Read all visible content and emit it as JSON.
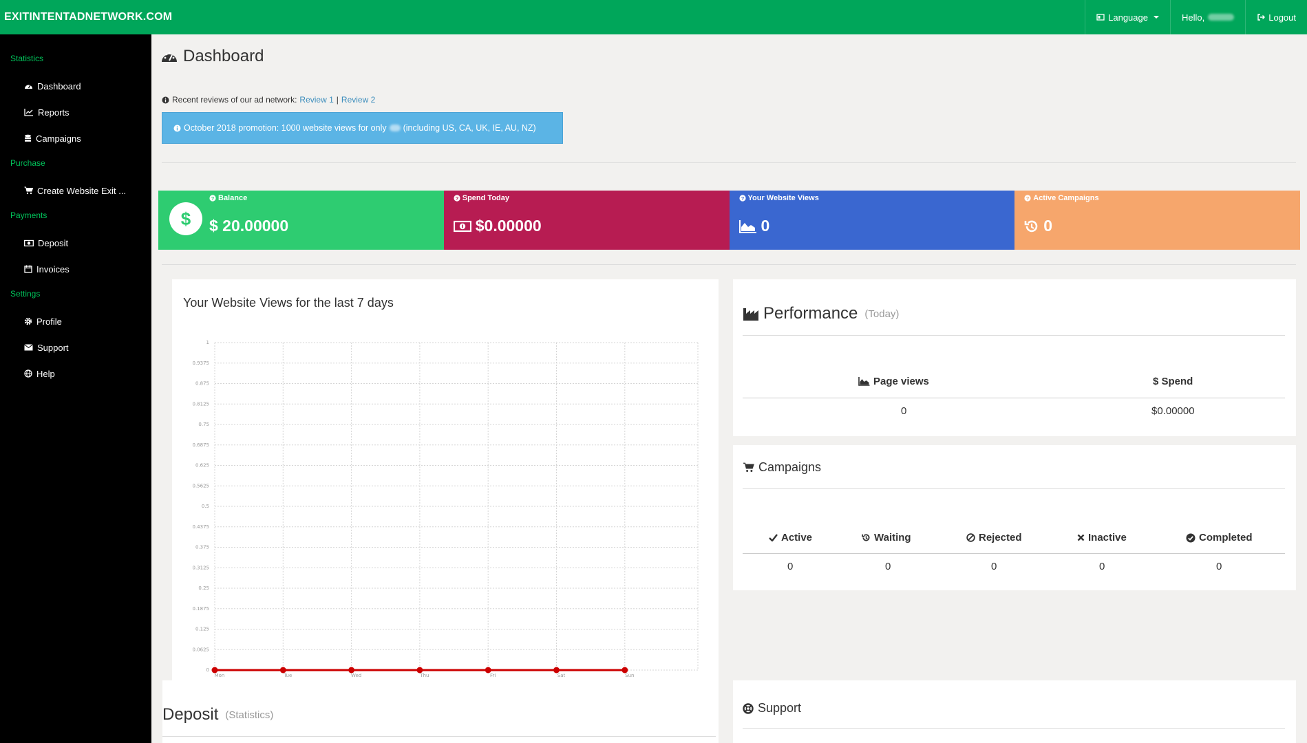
{
  "brand": "EXITINTENTADNETWORK.COM",
  "topnav": {
    "language": "Language",
    "hello": "Hello,",
    "logout": "Logout"
  },
  "sidebar": {
    "sections": [
      {
        "heading": "Statistics",
        "items": [
          {
            "label": "Dashboard",
            "icon": "dashboard-icon"
          },
          {
            "label": "Reports",
            "icon": "line-chart-icon"
          },
          {
            "label": "Campaigns",
            "icon": "database-icon"
          }
        ]
      },
      {
        "heading": "Purchase",
        "items": [
          {
            "label": "Create Website Exit ...",
            "icon": "cart-icon"
          }
        ]
      },
      {
        "heading": "Payments",
        "items": [
          {
            "label": "Deposit",
            "icon": "money-icon"
          },
          {
            "label": "Invoices",
            "icon": "calendar-icon"
          }
        ]
      },
      {
        "heading": "Settings",
        "items": [
          {
            "label": "Profile",
            "icon": "gear-icon"
          },
          {
            "label": "Support",
            "icon": "envelope-icon"
          },
          {
            "label": "Help",
            "icon": "globe-icon"
          }
        ]
      }
    ]
  },
  "page": {
    "title": "Dashboard",
    "reviews_text": "Recent reviews of our ad network:",
    "review1": "Review 1",
    "review_sep": "|",
    "review2": "Review 2",
    "promo_before": "October 2018 promotion: 1000 website views for only",
    "promo_after": "(including US, CA, UK, IE, AU, NZ)"
  },
  "stats": [
    {
      "label": "Balance",
      "value": "$ 20.00000",
      "color": "#2ecc71"
    },
    {
      "label": "Spend Today",
      "value": "$0.00000",
      "color": "#b71c52"
    },
    {
      "label": "Your Website Views",
      "value": "0",
      "color": "#3a67d0"
    },
    {
      "label": "Active Campaigns",
      "value": "0",
      "color": "#f6a66c"
    }
  ],
  "views_panel": {
    "title": "Your Website Views for the last 7 days"
  },
  "chart_data": {
    "type": "line",
    "title": "Your Website Views for the last 7 days",
    "categories": [
      "Mon",
      "Tue",
      "Wed",
      "Thu",
      "Fri",
      "Sat",
      "Sun"
    ],
    "values": [
      0,
      0,
      0,
      0,
      0,
      0,
      0
    ],
    "y_ticks": [
      "1",
      "0.9375",
      "0.875",
      "0.8125",
      "0.75",
      "0.6875",
      "0.625",
      "0.5625",
      "0.5",
      "0.4375",
      "0.375",
      "0.3125",
      "0.25",
      "0.1875",
      "0.125",
      "0.0625",
      "0"
    ],
    "ylim": [
      0,
      1
    ],
    "grid": true,
    "line_color": "#cc0000"
  },
  "performance": {
    "title": "Performance",
    "subtitle": "(Today)",
    "col1": "Page views",
    "col2": "$ Spend",
    "val1": "0",
    "val2": "$0.00000"
  },
  "campaigns": {
    "title": "Campaigns",
    "cols": [
      "Active",
      "Waiting",
      "Rejected",
      "Inactive",
      "Completed"
    ],
    "vals": [
      "0",
      "0",
      "0",
      "0",
      "0"
    ]
  },
  "deposit": {
    "title": "Deposit",
    "subtitle": "(Statistics)"
  },
  "support": {
    "title": "Support"
  }
}
